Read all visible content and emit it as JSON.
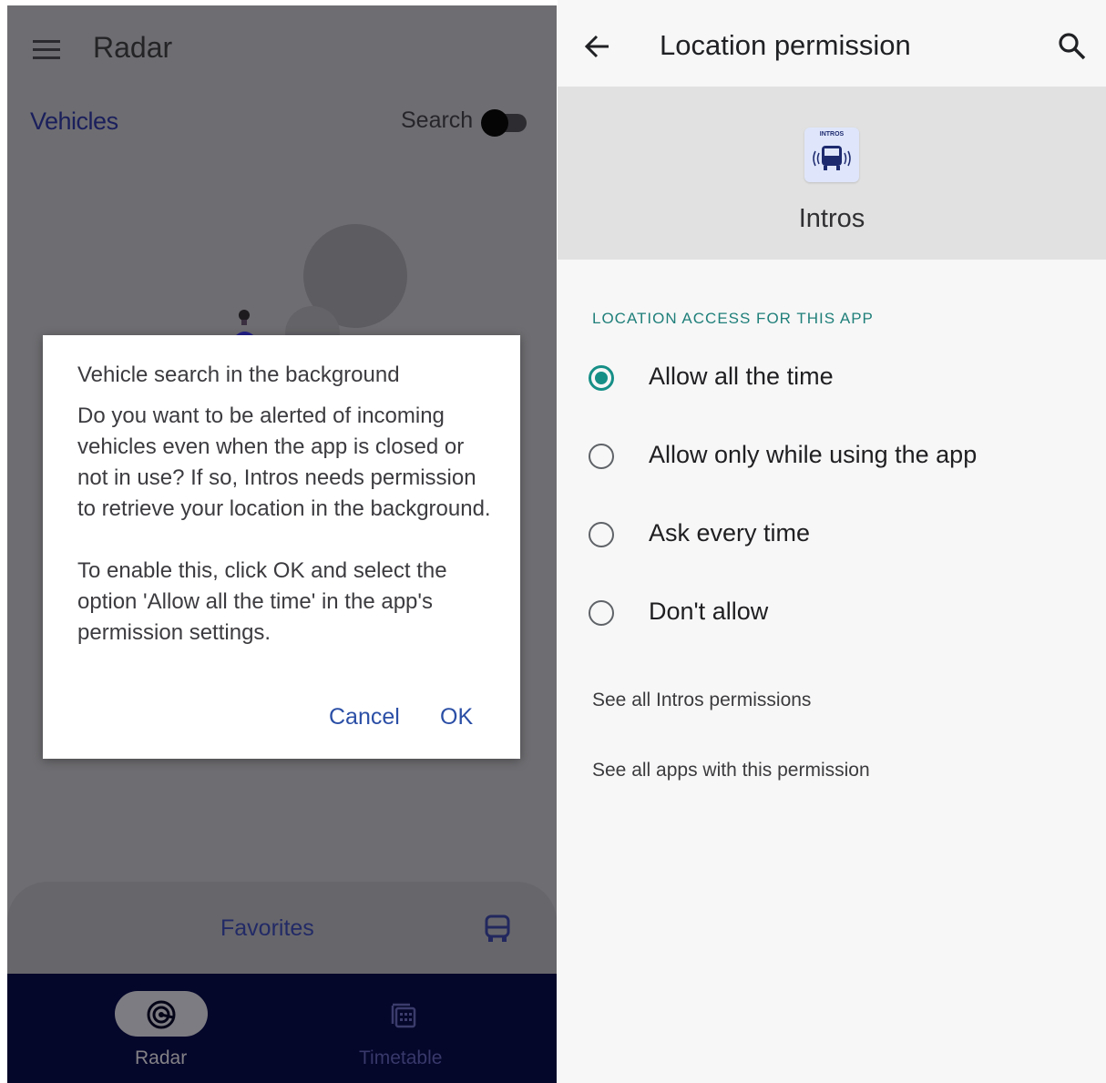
{
  "left": {
    "title": "Radar",
    "section_title": "Vehicles",
    "search_label": "Search",
    "search_toggle_on": false,
    "dialog": {
      "title": "Vehicle search in the background",
      "message": "Do you want to be alerted of incoming vehicles even when the app is closed or not in use? If so, Intros needs permission to retrieve your location in the background.\n\nTo enable this, click OK and select the option 'Allow all the time' in the app's permission settings.",
      "cancel_label": "Cancel",
      "ok_label": "OK"
    },
    "favorites_label": "Favorites",
    "nav": [
      {
        "label": "Radar",
        "icon": "radar-icon",
        "active": true
      },
      {
        "label": "Timetable",
        "icon": "timetable-icon",
        "active": false
      }
    ]
  },
  "right": {
    "title": "Location permission",
    "app_icon_text": "INTROS",
    "app_name": "Intros",
    "section_caption": "LOCATION ACCESS FOR THIS APP",
    "options": [
      {
        "label": "Allow all the time",
        "selected": true
      },
      {
        "label": "Allow only while using the app",
        "selected": false
      },
      {
        "label": "Ask every time",
        "selected": false
      },
      {
        "label": "Don't allow",
        "selected": false
      }
    ],
    "links": [
      "See all Intros permissions",
      "See all apps with this permission"
    ]
  },
  "colors": {
    "accent_teal": "#168f87",
    "dialog_button_blue": "#2b4fa6",
    "nav_background": "#04062a"
  }
}
